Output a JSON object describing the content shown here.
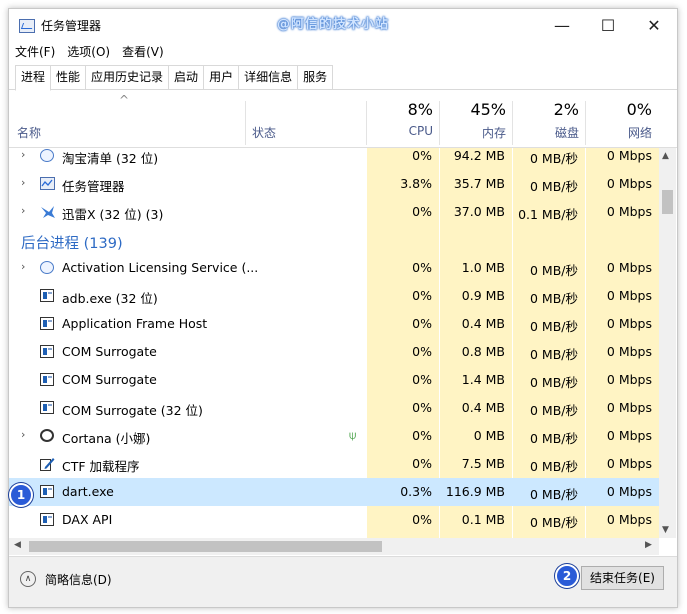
{
  "window": {
    "title": "任务管理器",
    "watermark": "@阿信的技术小站",
    "controls": {
      "minimize": "—",
      "maximize": "☐",
      "close": "✕"
    }
  },
  "menu": [
    "文件(F)",
    "选项(O)",
    "查看(V)"
  ],
  "tabs": [
    "进程",
    "性能",
    "应用历史记录",
    "启动",
    "用户",
    "详细信息",
    "服务"
  ],
  "active_tab": "进程",
  "header": {
    "name": "名称",
    "status": "状态",
    "cpu": {
      "pct": "8%",
      "label": "CPU"
    },
    "memory": {
      "pct": "45%",
      "label": "内存"
    },
    "disk": {
      "pct": "2%",
      "label": "磁盘"
    },
    "network": {
      "pct": "0%",
      "label": "网络"
    }
  },
  "rows": [
    {
      "type": "proc",
      "expander": "›",
      "icon": "gear",
      "name": "淘宝清单 (32 位)",
      "cpu": "0%",
      "mem": "94.2 MB",
      "disk": "0 MB/秒",
      "net": "0 Mbps"
    },
    {
      "type": "proc",
      "expander": "›",
      "icon": "taskmgr",
      "name": "任务管理器",
      "cpu": "3.8%",
      "mem": "35.7 MB",
      "disk": "0 MB/秒",
      "net": "0 Mbps"
    },
    {
      "type": "proc",
      "expander": "›",
      "icon": "bird",
      "name": "迅雷X (32 位) (3)",
      "cpu": "0%",
      "mem": "37.0 MB",
      "disk": "0.1 MB/秒",
      "net": "0 Mbps"
    },
    {
      "type": "group",
      "name": "后台进程 (139)"
    },
    {
      "type": "proc",
      "expander": "›",
      "icon": "gear",
      "name": "Activation Licensing Service (...",
      "cpu": "0%",
      "mem": "1.0 MB",
      "disk": "0 MB/秒",
      "net": "0 Mbps"
    },
    {
      "type": "proc",
      "expander": "",
      "icon": "win",
      "name": "adb.exe (32 位)",
      "cpu": "0%",
      "mem": "0.9 MB",
      "disk": "0 MB/秒",
      "net": "0 Mbps"
    },
    {
      "type": "proc",
      "expander": "",
      "icon": "win",
      "name": "Application Frame Host",
      "cpu": "0%",
      "mem": "0.4 MB",
      "disk": "0 MB/秒",
      "net": "0 Mbps"
    },
    {
      "type": "proc",
      "expander": "",
      "icon": "win",
      "name": "COM Surrogate",
      "cpu": "0%",
      "mem": "0.8 MB",
      "disk": "0 MB/秒",
      "net": "0 Mbps"
    },
    {
      "type": "proc",
      "expander": "",
      "icon": "win",
      "name": "COM Surrogate",
      "cpu": "0%",
      "mem": "1.4 MB",
      "disk": "0 MB/秒",
      "net": "0 Mbps"
    },
    {
      "type": "proc",
      "expander": "",
      "icon": "win",
      "name": "COM Surrogate (32 位)",
      "cpu": "0%",
      "mem": "0.4 MB",
      "disk": "0 MB/秒",
      "net": "0 Mbps"
    },
    {
      "type": "proc",
      "expander": "›",
      "icon": "circle",
      "name": "Cortana (小娜)",
      "leaf": true,
      "cpu": "0%",
      "mem": "0 MB",
      "disk": "0 MB/秒",
      "net": "0 Mbps"
    },
    {
      "type": "proc",
      "expander": "",
      "icon": "pen",
      "name": "CTF 加载程序",
      "cpu": "0%",
      "mem": "7.5 MB",
      "disk": "0 MB/秒",
      "net": "0 Mbps"
    },
    {
      "type": "proc",
      "expander": "",
      "icon": "win",
      "name": "dart.exe",
      "selected": true,
      "cpu": "0.3%",
      "mem": "116.9 MB",
      "disk": "0 MB/秒",
      "net": "0 Mbps"
    },
    {
      "type": "proc",
      "expander": "",
      "icon": "win",
      "name": "DAX API",
      "cpu": "0%",
      "mem": "0.1 MB",
      "disk": "0 MB/秒",
      "net": "0 Mbps"
    }
  ],
  "footer": {
    "fewer_details": "简略信息(D)",
    "end_task": "结束任务(E)"
  },
  "badges": [
    "1",
    "2"
  ],
  "colors": {
    "accent": "#2d6ac4",
    "selected_row": "#cce8ff",
    "heat": "#fff4c4",
    "badge": "#2a5bd7"
  }
}
